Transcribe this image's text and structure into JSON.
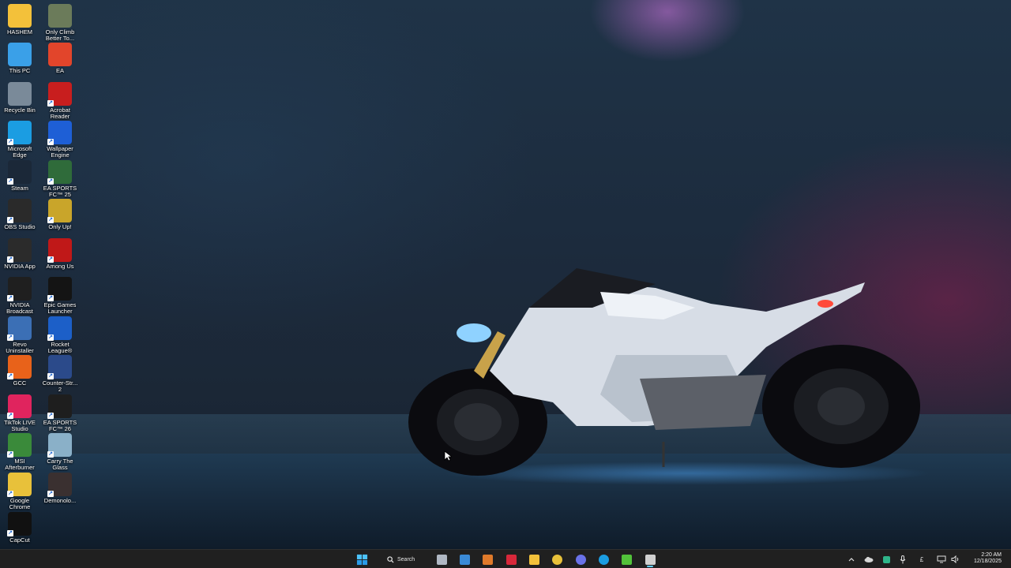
{
  "desktop": {
    "icons": [
      {
        "label": "HASHEM",
        "icon": "folder-icon",
        "color": "#f3c13a"
      },
      {
        "label": "Only Climb\nBetter To...",
        "icon": "game-icon",
        "color": "#6b7b5a"
      },
      {
        "label": "This PC",
        "icon": "monitor-icon",
        "color": "#3aa0e8"
      },
      {
        "label": "EA",
        "icon": "ea-icon",
        "color": "#e2452b"
      },
      {
        "label": "Recycle Bin",
        "icon": "recycle-bin-icon",
        "color": "#7a8a99"
      },
      {
        "label": "Acrobat\nReader",
        "icon": "acrobat-icon",
        "color": "#c81e1e"
      },
      {
        "label": "Microsoft\nEdge",
        "icon": "edge-icon",
        "color": "#1b9de2"
      },
      {
        "label": "Wallpaper\nEngine",
        "icon": "wallpaper-engine-icon",
        "color": "#1e5fd6"
      },
      {
        "label": "Steam",
        "icon": "steam-icon",
        "color": "#1b2838"
      },
      {
        "label": "EA SPORTS\nFC™ 25",
        "icon": "fc25-icon",
        "color": "#2f6b3a"
      },
      {
        "label": "OBS Studio",
        "icon": "obs-icon",
        "color": "#2a2a2a"
      },
      {
        "label": "Only Up!",
        "icon": "only-up-icon",
        "color": "#c9a52a"
      },
      {
        "label": "NVIDIA App",
        "icon": "nvidia-icon",
        "color": "#2b2b2b"
      },
      {
        "label": "Among Us",
        "icon": "among-us-icon",
        "color": "#c01818"
      },
      {
        "label": "NVIDIA\nBroadcast",
        "icon": "nvidia-broadcast-icon",
        "color": "#1f1f1f"
      },
      {
        "label": "Epic Games\nLauncher",
        "icon": "epic-games-icon",
        "color": "#141414"
      },
      {
        "label": "Revo\nUninstaller",
        "icon": "revo-icon",
        "color": "#3b6fb5"
      },
      {
        "label": "Rocket\nLeague®",
        "icon": "rocket-league-icon",
        "color": "#1c5fc8"
      },
      {
        "label": "GCC",
        "icon": "gcc-icon",
        "color": "#e8621a"
      },
      {
        "label": "Counter-Str...\n2",
        "icon": "cs2-icon",
        "color": "#2b4a8a"
      },
      {
        "label": "TikTok LIVE\nStudio",
        "icon": "tiktok-icon",
        "color": "#e0245e"
      },
      {
        "label": "EA SPORTS\nFC™ 26",
        "icon": "fc26-icon",
        "color": "#1e1e1e"
      },
      {
        "label": "MSI\nAfterburner",
        "icon": "msi-afterburner-icon",
        "color": "#3a8a3a"
      },
      {
        "label": "Carry The\nGlass",
        "icon": "carry-the-glass-icon",
        "color": "#8ab0c8"
      },
      {
        "label": "Google\nChrome",
        "icon": "chrome-icon",
        "color": "#e8c13a"
      },
      {
        "label": "Demonolo...",
        "icon": "demonologist-icon",
        "color": "#3a3030"
      },
      {
        "label": "CapCut",
        "icon": "capcut-icon",
        "color": "#111111"
      }
    ]
  },
  "taskbar": {
    "search_label": "Search",
    "apps": [
      {
        "name": "start-button",
        "icon": "windows-icon",
        "color": "#3aa0f0"
      },
      {
        "name": "settings",
        "icon": "gear-icon",
        "color": "#b0b8c4"
      },
      {
        "name": "photos",
        "icon": "photos-icon",
        "color": "#3a8ad6"
      },
      {
        "name": "onedrive-app",
        "icon": "cloud-icon",
        "color": "#e07a2a"
      },
      {
        "name": "red-app",
        "icon": "app-icon",
        "color": "#d8283a"
      },
      {
        "name": "file-explorer",
        "icon": "folder-icon",
        "color": "#f3c13a"
      },
      {
        "name": "chrome",
        "icon": "chrome-icon",
        "color": "#e8c13a"
      },
      {
        "name": "discord",
        "icon": "discord-icon",
        "color": "#6a72e8"
      },
      {
        "name": "edge",
        "icon": "edge-icon",
        "color": "#1b9de2"
      },
      {
        "name": "game-app",
        "icon": "play-icon",
        "color": "#52c23a"
      },
      {
        "name": "active-app",
        "icon": "app-icon",
        "color": "#d0d0d0"
      }
    ],
    "tray": {
      "currency": "£",
      "time": "2:20 AM",
      "date": "12/18/2025"
    }
  }
}
